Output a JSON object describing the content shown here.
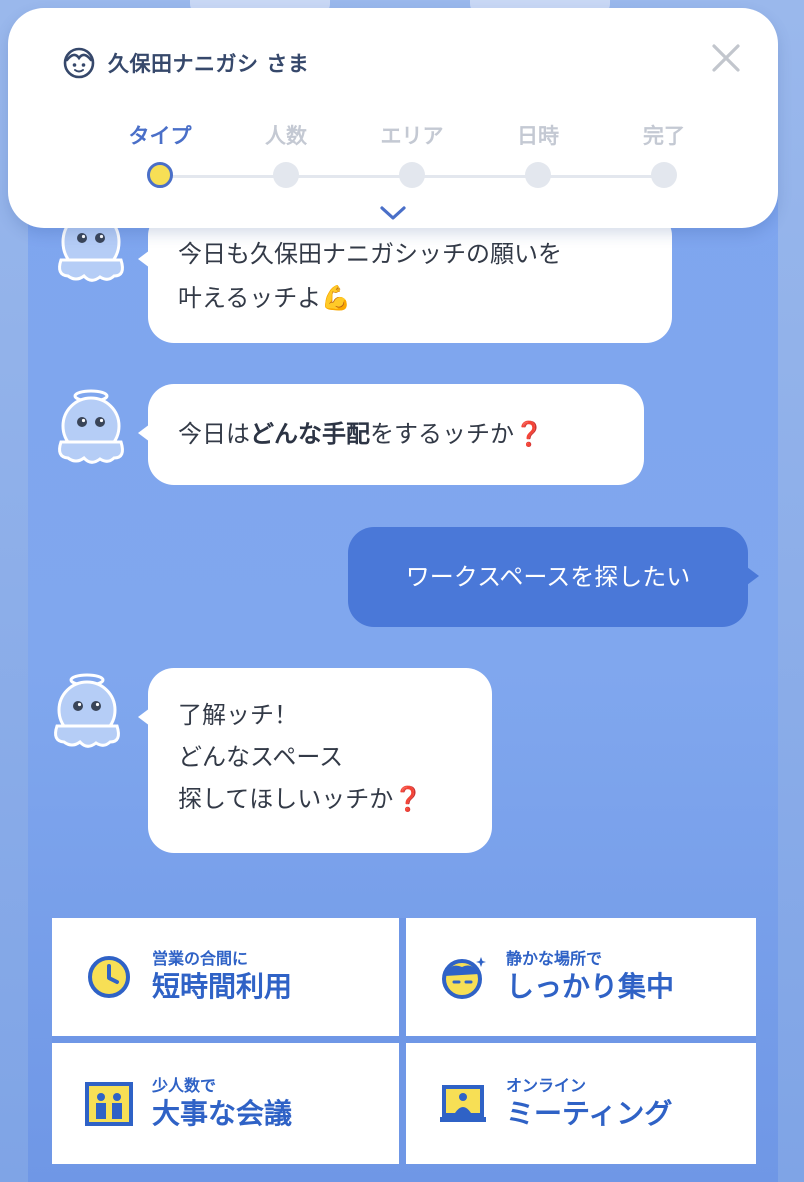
{
  "header": {
    "user_name": "久保田ナニガシ さま"
  },
  "steps": [
    {
      "label": "タイプ",
      "active": true
    },
    {
      "label": "人数",
      "active": false
    },
    {
      "label": "エリア",
      "active": false
    },
    {
      "label": "日時",
      "active": false
    },
    {
      "label": "完了",
      "active": false
    }
  ],
  "chat": {
    "msg1_line1": "今日も久保田ナニガシッチの願いを",
    "msg1_line2": "叶えるッチよ",
    "msg1_emoji": "💪",
    "msg2_pre": "今日は",
    "msg2_bold": "どんな手配",
    "msg2_post": "をするッチか",
    "msg2_q": "❓",
    "user_msg": "ワークスペースを探したい",
    "msg3_line1": "了解ッチ！",
    "msg3_line2": "どんなスペース",
    "msg3_line3": "探してほしいッチか",
    "msg3_q": "❓"
  },
  "options": [
    {
      "small": "営業の合間に",
      "big": "短時間利用",
      "icon": "clock-icon"
    },
    {
      "small": "静かな場所で",
      "big": "しっかり集中",
      "icon": "focus-face-icon"
    },
    {
      "small": "少人数で",
      "big": "大事な会議",
      "icon": "meeting-room-icon"
    },
    {
      "small": "オンライン",
      "big": "ミーティング",
      "icon": "laptop-person-icon"
    }
  ],
  "colors": {
    "accent": "#4a6fc8",
    "user_bubble": "#4a78d8",
    "option_text": "#2f62c6",
    "active_dot": "#f7df55",
    "panel_bg": "#7ea5ef"
  }
}
